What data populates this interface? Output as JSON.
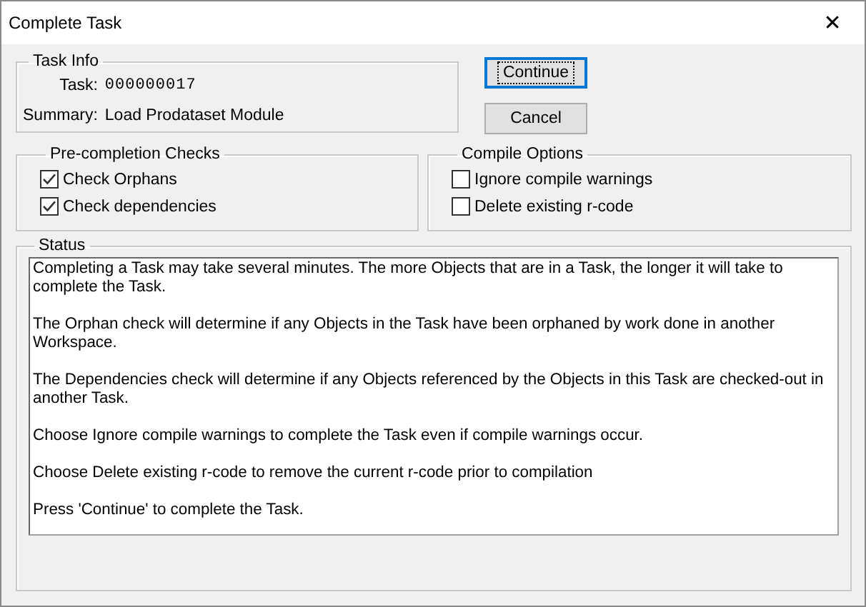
{
  "window": {
    "title": "Complete Task",
    "close": "✕"
  },
  "task_info": {
    "title": "Task Info",
    "task_label": "Task:",
    "task_value": "000000017",
    "summary_label": "Summary:",
    "summary_value": "Load Prodataset Module"
  },
  "buttons": [
    {
      "label": "Continue",
      "default": true
    },
    {
      "label": "Cancel",
      "default": false
    }
  ],
  "pre_completion_checks": {
    "title": "Pre-completion Checks",
    "items": [
      {
        "label": "Check Orphans",
        "checked": true
      },
      {
        "label": "Check dependencies",
        "checked": true
      }
    ]
  },
  "compile_options": {
    "title": "Compile Options",
    "items": [
      {
        "label": "Ignore compile warnings",
        "checked": false
      },
      {
        "label": "Delete existing r-code",
        "checked": false
      }
    ]
  },
  "status": {
    "title": "Status",
    "paragraphs": [
      "Completing a Task may take several minutes. The more Objects that are in a Task, the longer it will take to complete the Task.",
      "The Orphan check will determine if any Objects in the Task have been orphaned by work done in another Workspace.",
      "The Dependencies check will determine if any Objects referenced by the Objects in this Task are checked-out in another Task.",
      "Choose Ignore compile warnings to complete the Task even if compile warnings occur.",
      "Choose Delete existing r-code to remove the current r-code prior to compilation",
      "Press 'Continue' to complete the Task."
    ]
  }
}
